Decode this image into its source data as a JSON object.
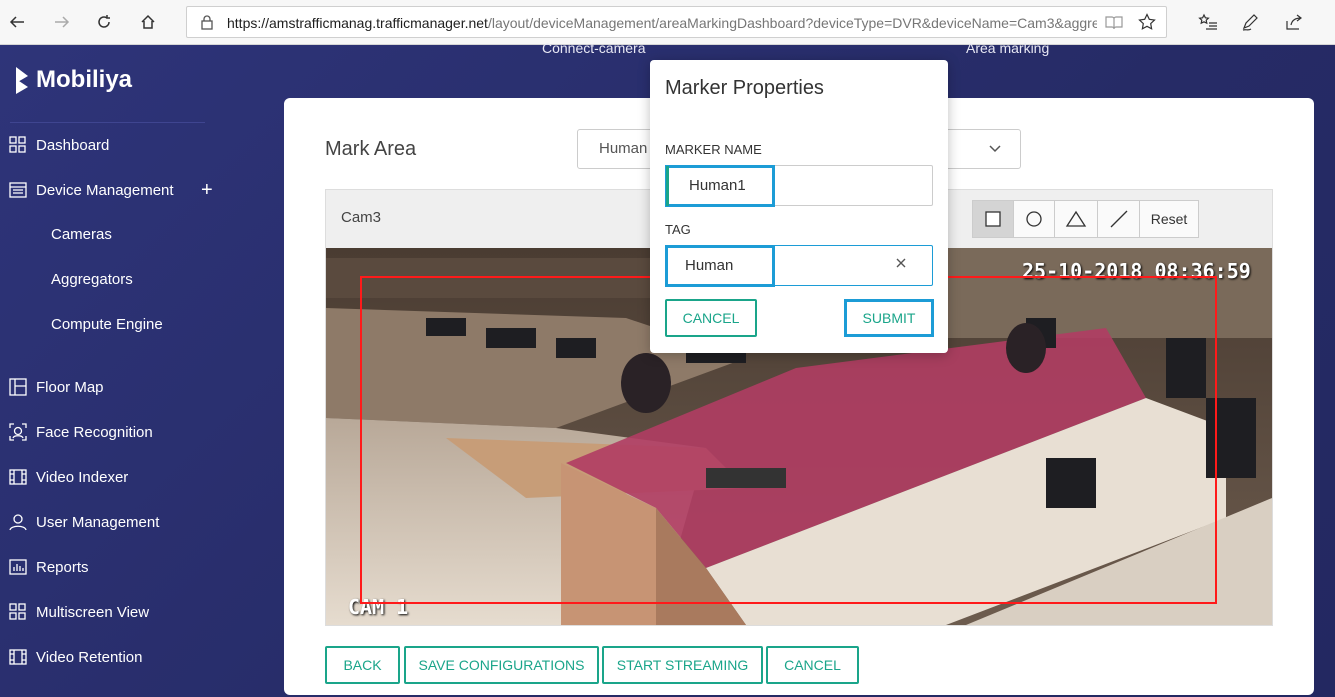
{
  "browser": {
    "url_host": "https://amstrafficmanag.trafficmanager.net",
    "url_path": "/layout/deviceManagement/areaMarkingDashboard?deviceType=DVR&deviceName=Cam3&aggregatorNam"
  },
  "steps": {
    "connect": "Connect-camera",
    "marking": "Area marking"
  },
  "brand": {
    "name": "Mobiliya"
  },
  "sidebar": {
    "items": [
      {
        "label": "Dashboard",
        "icon": "grid-icon"
      },
      {
        "label": "Device Management",
        "icon": "device-list-icon"
      },
      {
        "label": "Floor Map",
        "icon": "floor-map-icon"
      },
      {
        "label": "Face Recognition",
        "icon": "face-scan-icon"
      },
      {
        "label": "Video Indexer",
        "icon": "film-icon"
      },
      {
        "label": "User Management",
        "icon": "user-icon"
      },
      {
        "label": "Reports",
        "icon": "bar-chart-icon"
      },
      {
        "label": "Multiscreen View",
        "icon": "grid-icon"
      },
      {
        "label": "Video Retention",
        "icon": "film-icon"
      }
    ],
    "sub_items": [
      "Cameras",
      "Aggregators",
      "Compute Engine"
    ]
  },
  "main": {
    "title": "Mark Area",
    "select_value": "Human",
    "camera_name": "Cam3",
    "toolbar": {
      "reset_label": "Reset"
    },
    "feed": {
      "timestamp": "25-10-2018 08:36:59",
      "cam_label": "CAM 1"
    },
    "buttons": {
      "back": "BACK",
      "save": "SAVE CONFIGURATIONS",
      "start": "START STREAMING",
      "cancel": "CANCEL"
    }
  },
  "modal": {
    "title": "Marker Properties",
    "marker_name_label": "MARKER NAME",
    "marker_name_value": "Human1",
    "tag_label": "TAG",
    "tag_value": "Human",
    "cancel": "CANCEL",
    "submit": "SUBMIT"
  },
  "colors": {
    "accent": "#1aa58a",
    "sidebar_bg": "#2a2f6b",
    "focus": "#1c9cd6",
    "marker": "#ff1a1a"
  }
}
